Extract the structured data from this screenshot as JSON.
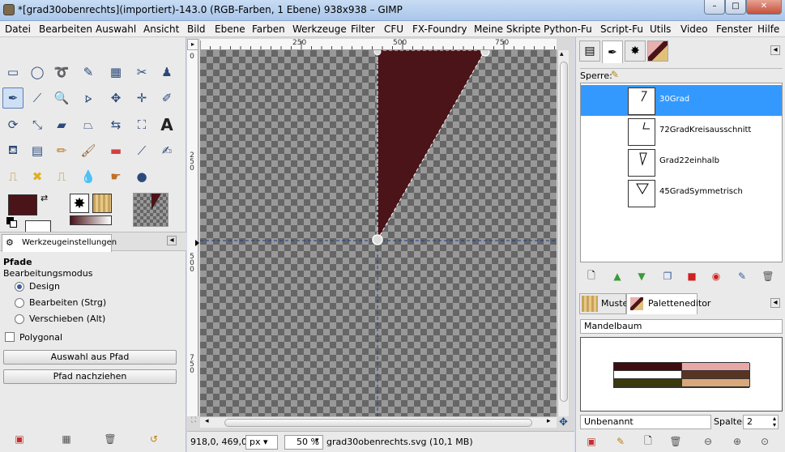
{
  "window": {
    "title": "*[grad30obenrechts](importiert)-143.0 (RGB-Farben, 1 Ebene) 938x938 – GIMP",
    "minimize": "–",
    "maximize": "□",
    "close": "✕"
  },
  "menu": [
    "Datei",
    "Bearbeiten",
    "Auswahl",
    "Ansicht",
    "Bild",
    "Ebene",
    "Farben",
    "Werkzeuge",
    "Filter",
    "CFU",
    "FX-Foundry",
    "Meine Skripte",
    "Python-Fu",
    "Script-Fu",
    "Utils",
    "Video",
    "Fenster",
    "Hilfe"
  ],
  "toolbox": {
    "tools": [
      "rect-select",
      "ellipse-select",
      "free-select",
      "fuzzy-select",
      "color-select",
      "scissors-select",
      "foreground-select",
      "paths",
      "color-picker",
      "zoom",
      "measure",
      "move",
      "align",
      "crop",
      "rotate",
      "scale",
      "shear",
      "perspective",
      "flip",
      "cage",
      "text",
      "bucket-fill",
      "blend",
      "pencil",
      "paintbrush",
      "eraser",
      "airbrush",
      "ink",
      "clone",
      "heal",
      "perspective-clone",
      "blur",
      "smudge",
      "dodge-burn"
    ],
    "active_tool": "paths",
    "fg_color": "#4a1419",
    "bg_color": "#ffffff",
    "options_tab_label": "Werkzeugeinstellungen",
    "tool_name": "Pfade",
    "mode_label": "Bearbeitungsmodus",
    "modes": [
      "Design",
      "Bearbeiten (Strg)",
      "Verschieben (Alt)"
    ],
    "selected_mode": "Design",
    "polygonal_label": "Polygonal",
    "polygonal_checked": false,
    "button_selection_from_path": "Auswahl aus Pfad",
    "button_stroke_path": "Pfad nachziehen"
  },
  "canvas": {
    "hruler_ticks": [
      "250",
      "500",
      "750"
    ],
    "vruler_ticks": [
      "0",
      "250",
      "500",
      "750"
    ],
    "shape_color": "#4a1419",
    "pointer_coords": "918,0, 469,0",
    "unit": "px",
    "zoom": "50 %",
    "file_info": "grad30obenrechts.svg (10,1 MB)"
  },
  "paths_dock": {
    "lock_label": "Sperre:",
    "paths": [
      {
        "name": "30Grad",
        "selected": true
      },
      {
        "name": "72GradKreisausschnitt",
        "selected": false
      },
      {
        "name": "Grad22einhalb",
        "selected": false
      },
      {
        "name": "45GradSymmetrisch",
        "selected": false
      }
    ]
  },
  "palette_dock": {
    "tab_patterns": "Muster",
    "tab_palette_editor": "Paletteneditor",
    "palette_name": "Mandelbaum",
    "swatches": [
      "#3e0d10",
      "#e8a8a8",
      "#ffffff",
      "#5a3422",
      "#3a3a0a",
      "#d9a87a"
    ],
    "color_name": "Unbenannt",
    "columns_label": "Spalten:",
    "columns_value": "2"
  }
}
